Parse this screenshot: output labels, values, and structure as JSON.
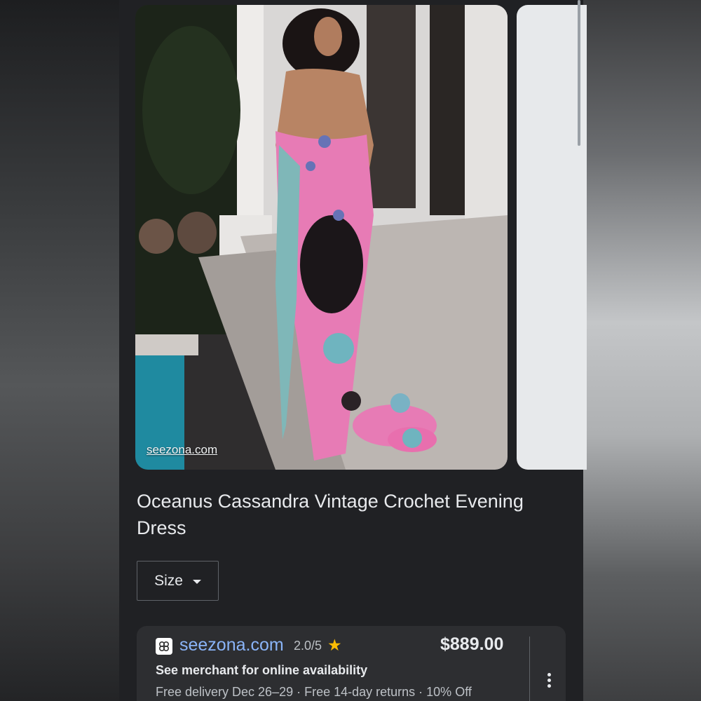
{
  "image": {
    "source_label": "seezona.com"
  },
  "product": {
    "title": "Oceanus Cassandra Vintage Crochet Evening Dress"
  },
  "filters": {
    "size_label": "Size"
  },
  "offer": {
    "merchant": "seezona.com",
    "rating": "2.0/5",
    "price": "$889.00",
    "availability": "See merchant for online availability",
    "details": "Free delivery Dec 26–29 · Free 14-day returns · 10% Off"
  },
  "icons": {
    "rating": "star-icon",
    "dropdown": "chevron-down-icon",
    "menu": "more-vert-icon",
    "merchant": "merchant-logo-icon"
  },
  "colors": {
    "link": "#8ab4f8",
    "star": "#fbbc04",
    "surface": "#202124",
    "card": "#2d2e31"
  }
}
